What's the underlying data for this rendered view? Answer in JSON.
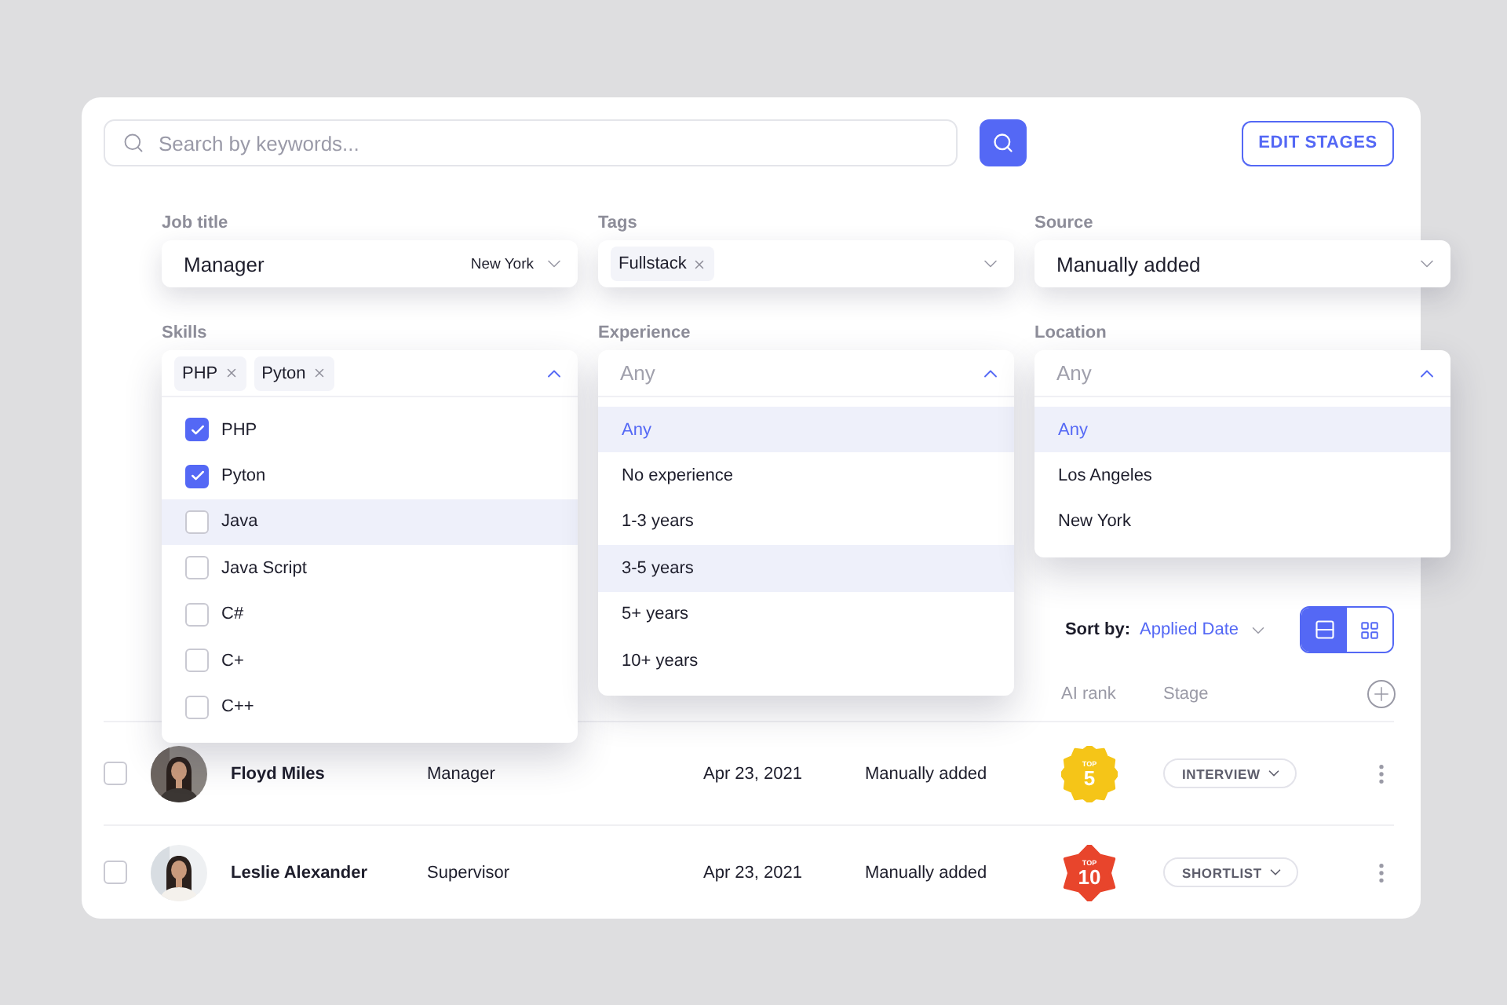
{
  "search": {
    "placeholder": "Search by keywords..."
  },
  "edit_stages_button": "EDIT STAGES",
  "filters": [
    {
      "label": "Job title",
      "kind": "select",
      "value": "Manager",
      "hint": "New York",
      "expanded": false
    },
    {
      "label": "Tags",
      "kind": "tags",
      "tags": [
        "Fullstack"
      ],
      "expanded": false
    },
    {
      "label": "Source",
      "kind": "select",
      "value": "Manually added",
      "expanded": false
    },
    {
      "label": "Skills",
      "kind": "tags",
      "tags": [
        "PHP",
        "Pyton"
      ],
      "expanded": true,
      "options": [
        {
          "label": "PHP",
          "checked": true,
          "highlighted": false
        },
        {
          "label": "Pyton",
          "checked": true,
          "highlighted": false
        },
        {
          "label": "Java",
          "checked": false,
          "highlighted": true
        },
        {
          "label": "Java Script",
          "checked": false,
          "highlighted": false
        },
        {
          "label": "C#",
          "checked": false,
          "highlighted": false
        },
        {
          "label": "C+",
          "checked": false,
          "highlighted": false
        },
        {
          "label": "C++",
          "checked": false,
          "highlighted": false
        }
      ]
    },
    {
      "label": "Experience",
      "kind": "select",
      "placeholder": "Any",
      "expanded": true,
      "options": [
        {
          "label": "Any",
          "selected": true,
          "highlighted": true
        },
        {
          "label": "No experience",
          "selected": false,
          "highlighted": false
        },
        {
          "label": "1-3 years",
          "selected": false,
          "highlighted": false
        },
        {
          "label": "3-5 years",
          "selected": false,
          "highlighted": true
        },
        {
          "label": "5+ years",
          "selected": false,
          "highlighted": false
        },
        {
          "label": "10+ years",
          "selected": false,
          "highlighted": false
        }
      ]
    },
    {
      "label": "Location",
      "kind": "select",
      "placeholder": "Any",
      "expanded": true,
      "options": [
        {
          "label": "Any",
          "selected": true,
          "highlighted": true
        },
        {
          "label": "Los Angeles",
          "selected": false,
          "highlighted": false
        },
        {
          "label": "New York",
          "selected": false,
          "highlighted": false
        }
      ]
    }
  ],
  "sort": {
    "label": "Sort by:",
    "value": "Applied Date"
  },
  "view_toggle": [
    {
      "kind": "list",
      "selected": true
    },
    {
      "kind": "grid",
      "selected": false
    }
  ],
  "table": {
    "header": [
      "AI rank",
      "Stage"
    ],
    "rows": [
      {
        "checked": false,
        "name": "Floyd Miles",
        "title": "Manager",
        "date": "Apr 23, 2021",
        "source": "Manually added",
        "rank": {
          "top": "TOP",
          "number": "5",
          "color": "#f5c518"
        },
        "stage": "INTERVIEW"
      },
      {
        "checked": false,
        "name": "Leslie Alexander",
        "title": "Supervisor",
        "date": "Apr 23, 2021",
        "source": "Manually added",
        "rank": {
          "top": "TOP",
          "number": "10",
          "color": "#e8452c"
        },
        "stage": "SHORTLIST"
      }
    ]
  }
}
